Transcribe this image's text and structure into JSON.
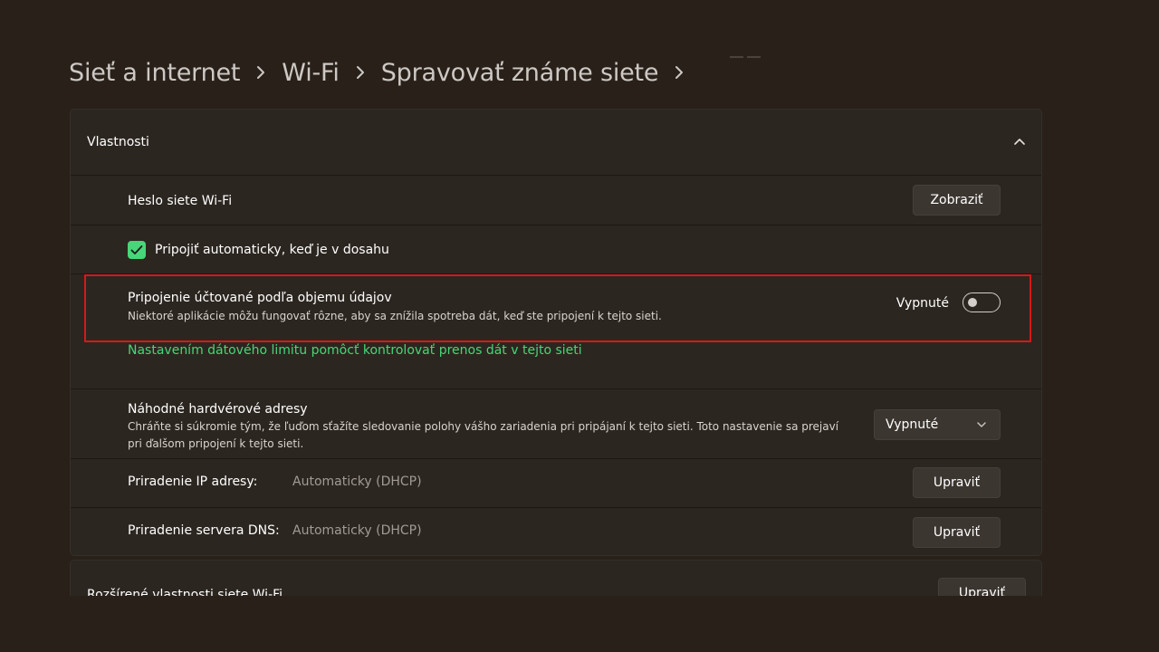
{
  "breadcrumb": {
    "items": [
      "Sieť a internet",
      "Wi-Fi",
      "Spravovať známe siete"
    ]
  },
  "properties": {
    "title": "Vlastnosti ",
    "password": {
      "label": "Heslo siete Wi-Fi",
      "button": "Zobraziť"
    },
    "auto_connect": {
      "label": "Pripojiť automaticky, keď je v dosahu",
      "checked": true
    },
    "metered": {
      "label": "Pripojenie účtované podľa objemu údajov",
      "description": "Niektoré aplikácie môžu fungovať rôzne, aby sa znížila spotreba dát, keď ste pripojení k tejto sieti.",
      "state_label": "Vypnuté",
      "enabled": false
    },
    "data_limit_link": "Nastavením dátového limitu pomôcť kontrolovať prenos dát v tejto sieti",
    "random_hw": {
      "label": "Náhodné hardvérové adresy",
      "description": "Chráňte si súkromie tým, že ľuďom sťažíte sledovanie polohy vášho zariadenia pri pripájaní k tejto sieti. Toto nastavenie sa prejaví pri ďalšom pripojení k tejto sieti.",
      "selected": "Vypnuté"
    },
    "ip": {
      "label": "Priradenie IP adresy:",
      "value": "Automaticky (DHCP)",
      "button": "Upraviť"
    },
    "dns": {
      "label": "Priradenie servera DNS:",
      "value": "Automaticky (DHCP)",
      "button": "Upraviť"
    }
  },
  "advanced": {
    "title": "Rozšírené vlastnosti siete Wi-Fi",
    "button": "Upraviť"
  },
  "colors": {
    "background": "#282019",
    "panel": "#2c2620",
    "accent_green": "#47d679",
    "highlight_red": "#d21a1a"
  }
}
